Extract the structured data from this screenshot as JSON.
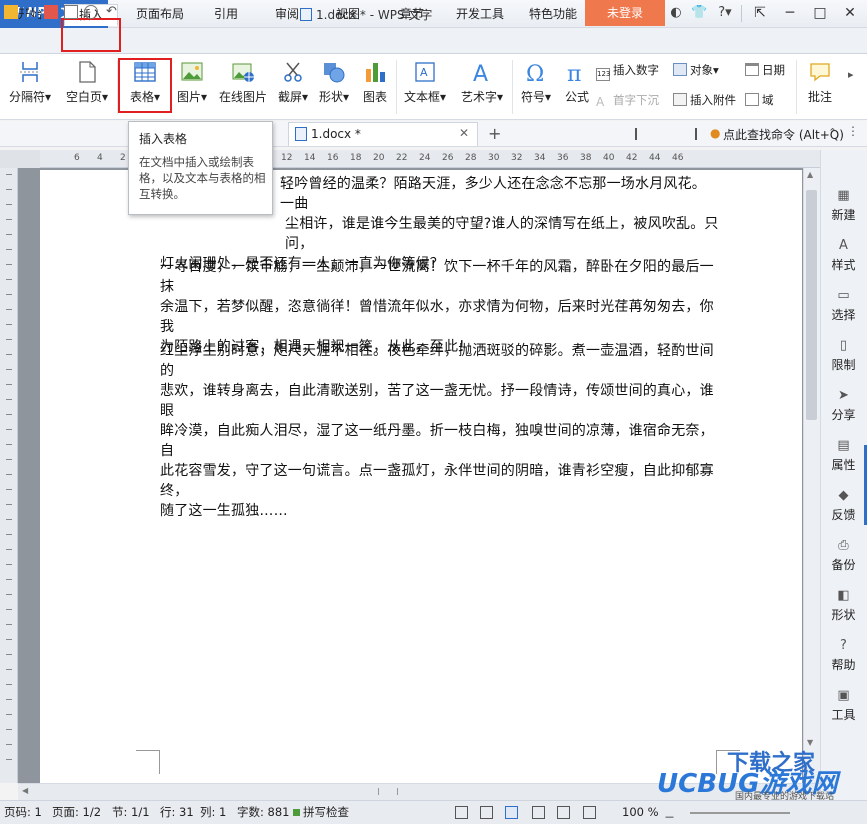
{
  "app": {
    "name": "WPS 文字",
    "doc_title": "1.docx * - WPS 文字",
    "login_button": "未登录"
  },
  "menu": {
    "tabs": [
      "开始",
      "插入",
      "页面布局",
      "引用",
      "审阅",
      "视图",
      "章节",
      "开发工具",
      "特色功能"
    ],
    "active": "插入"
  },
  "ribbon": {
    "buttons": [
      {
        "label": "分隔符",
        "icon": "page-break-icon"
      },
      {
        "label": "空白页",
        "icon": "blank-page-icon"
      },
      {
        "label": "表格",
        "icon": "table-grid-icon"
      },
      {
        "label": "图片",
        "icon": "picture-icon"
      },
      {
        "label": "在线图片",
        "icon": "online-picture-icon"
      },
      {
        "label": "截屏",
        "icon": "screenshot-icon"
      },
      {
        "label": "形状",
        "icon": "shapes-icon"
      },
      {
        "label": "图表",
        "icon": "chart-icon"
      },
      {
        "label": "文本框",
        "icon": "textbox-icon"
      },
      {
        "label": "艺术字",
        "icon": "wordart-icon"
      },
      {
        "label": "符号",
        "icon": "omega-icon"
      },
      {
        "label": "公式",
        "icon": "pi-icon"
      },
      {
        "label": "批注",
        "icon": "comment-icon"
      }
    ],
    "small": {
      "insert_number": "插入数字",
      "object": "对象",
      "date": "日期",
      "drop_cap": "首字下沉",
      "attachment": "插入附件",
      "field": "域"
    }
  },
  "doc_tab": {
    "label": "1.docx *"
  },
  "search_command": "点此查找命令 (Alt+Q)",
  "tooltip": {
    "title": "插入表格",
    "body": "在文档中插入或绘制表格，以及文本与表格的相互转换。"
  },
  "document": {
    "paragraphs": [
      {
        "lines": [
          "轻吟曾经的温柔？陌路天涯，多少人还在念念不忘那一场水月风花。一曲",
          "尘相许，谁是谁今生最美的守望?谁人的深情写在纸上，被风吹乱。只问，",
          "灯火阑珊处，是否还有一人，一直为你等候？"
        ]
      },
      {
        "lines": [
          "一寻百度，一饮千觞，一生颠沛，一世流离！饮下一杯千年的风霜，醉卧在夕阳的最后一抹",
          "余温下，若梦似醒，恣意徜徉！曾惜流年似水，亦求情为何物，后来时光荏苒匆匆去，你我",
          "为陌路上的过客，相遇，相视一笑，从此，至此！"
        ]
      },
      {
        "lines": [
          "红尘浮生别时意，咫尺天涯不相往。夜色牵绊，抛洒斑驳的碎影。煮一壶温酒，轻酌世间的",
          "悲欢，谁转身离去，自此清歌送别，苦了这一盏无忧。抒一段情诗，传颂世间的真心，谁眼",
          "眸冷漠，自此痴人泪尽，湿了这一纸丹墨。折一枝白梅，独嗅世间的凉薄，谁宿命无奈，自",
          "此花容雪发，守了这一句谎言。点一盏孤灯，永伴世间的阴暗，谁青衫空瘦，自此抑郁寡终，",
          "随了这一生孤独……"
        ]
      }
    ]
  },
  "sidebar": [
    "新建",
    "样式",
    "选择",
    "限制",
    "分享",
    "属性",
    "反馈",
    "备份",
    "形状",
    "帮助",
    "工具"
  ],
  "status": {
    "page_code": "页码: 1",
    "page": "页面: 1/2",
    "section": "节: 1/1",
    "row": "行: 31",
    "col": "列: 1",
    "words": "字数: 881",
    "spell": "拼写检查",
    "zoom": "100 %"
  },
  "ruler_numbers": [
    "6",
    "4",
    "2",
    "2",
    "4",
    "6",
    "8",
    "10",
    "12",
    "14",
    "16",
    "18",
    "20",
    "22",
    "24",
    "26",
    "28",
    "30",
    "32",
    "34",
    "36",
    "38",
    "40",
    "42",
    "44",
    "46"
  ],
  "watermark": {
    "line1": "下载之家",
    "line2": "UCBUG游戏网",
    "line3": "国内最专业的游戏下载站"
  },
  "colors": {
    "accent": "#2f6fc9",
    "login": "#f0784d",
    "highlight": "#e02020"
  }
}
